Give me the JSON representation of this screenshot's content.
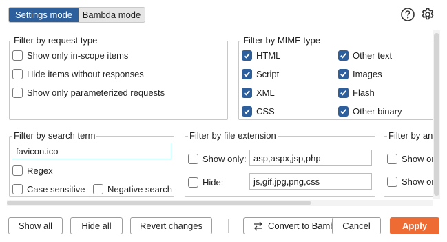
{
  "mode_toggle": {
    "active": "Settings mode",
    "inactive": "Bambda mode"
  },
  "icons": {
    "help": "help-circle-icon",
    "settings": "gear-icon",
    "convert": "swap-arrows-icon",
    "check": "checkmark-icon"
  },
  "colors": {
    "accent": "#2e5f9d",
    "apply": "#ee6b34",
    "border": "#c8c8c8"
  },
  "request_type": {
    "title": "Filter by request type",
    "items": [
      {
        "label": "Show only in-scope items",
        "checked": false
      },
      {
        "label": "Hide items without responses",
        "checked": false
      },
      {
        "label": "Show only parameterized requests",
        "checked": false
      }
    ]
  },
  "mime_type": {
    "title": "Filter by MIME type",
    "items": [
      {
        "label": "HTML",
        "checked": true
      },
      {
        "label": "Other text",
        "checked": true
      },
      {
        "label": "Script",
        "checked": true
      },
      {
        "label": "Images",
        "checked": true
      },
      {
        "label": "XML",
        "checked": true
      },
      {
        "label": "Flash",
        "checked": true
      },
      {
        "label": "CSS",
        "checked": true
      },
      {
        "label": "Other binary",
        "checked": true
      }
    ]
  },
  "search_term": {
    "title": "Filter by search term",
    "value": "favicon.ico",
    "regex": {
      "label": "Regex",
      "checked": false
    },
    "case_sensitive": {
      "label": "Case sensitive",
      "checked": false
    },
    "negative": {
      "label": "Negative search",
      "checked": false
    }
  },
  "file_extension": {
    "title": "Filter by file extension",
    "show_only": {
      "label": "Show only:",
      "checked": false,
      "value": "asp,aspx,jsp,php"
    },
    "hide": {
      "label": "Hide:",
      "checked": false,
      "value": "js,gif,jpg,png,css"
    }
  },
  "annotation": {
    "title": "Filter by ann",
    "show_only_1": {
      "label": "Show or",
      "checked": false
    },
    "show_only_2": {
      "label": "Show or",
      "checked": false
    }
  },
  "buttons": {
    "show_all": "Show all",
    "hide_all": "Hide all",
    "revert": "Revert changes",
    "convert": "Convert to Bamb",
    "cancel": "Cancel",
    "apply": "Apply"
  }
}
